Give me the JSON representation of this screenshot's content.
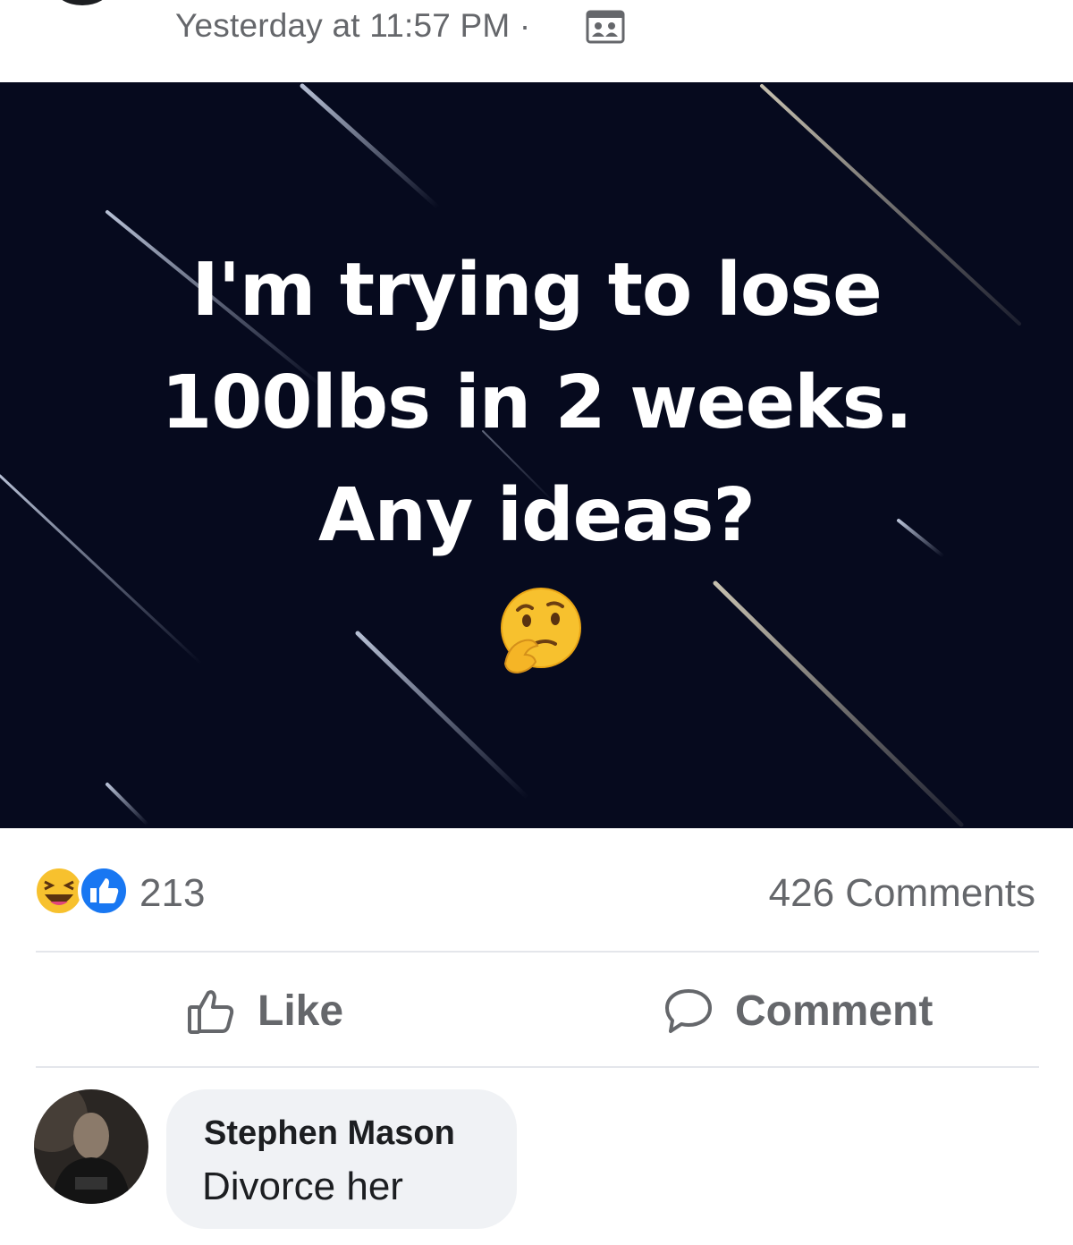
{
  "post": {
    "timestamp": "Yesterday at 11:57 PM ·",
    "privacy_icon": "friends-list-icon",
    "image_text_lines": [
      "I'm trying to lose",
      "100lbs in 2 weeks.",
      "Any ideas?"
    ],
    "image_emoji": "thinking-face-emoji",
    "image_background": "#060a1e"
  },
  "stats": {
    "reactions": [
      "haha-reaction-icon",
      "like-reaction-icon"
    ],
    "reaction_count": "213",
    "comment_count": "426 Comments"
  },
  "actions": {
    "like_label": "Like",
    "comment_label": "Comment"
  },
  "comments": [
    {
      "author": "Stephen Mason",
      "text": "Divorce her"
    }
  ],
  "colors": {
    "secondary_text": "#65676b",
    "primary_text": "#1c1e21",
    "divider": "#e4e6eb",
    "comment_bubble": "#f0f2f5",
    "like_blue": "#1877f2"
  }
}
